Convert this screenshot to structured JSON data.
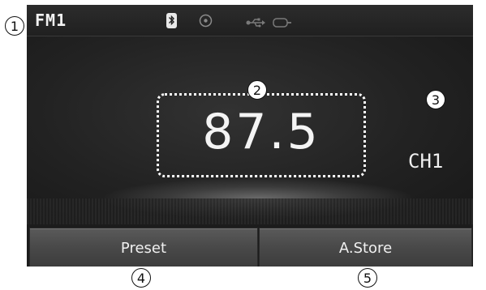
{
  "header": {
    "band": "FM1",
    "icons": [
      "bluetooth-icon",
      "disc-icon",
      "usb-icon",
      "aux-icon"
    ]
  },
  "tuner": {
    "frequency": "87.5",
    "channel": "CH1"
  },
  "buttons": {
    "preset": "Preset",
    "astore": "A.Store"
  },
  "callouts": [
    "1",
    "2",
    "3",
    "4",
    "5"
  ],
  "colors": {
    "screen_bg": "#1c1c1c",
    "button_bg": "#4a4a4a",
    "text": "#f2f2f2",
    "bluetooth_badge": "#e8e8e8"
  }
}
